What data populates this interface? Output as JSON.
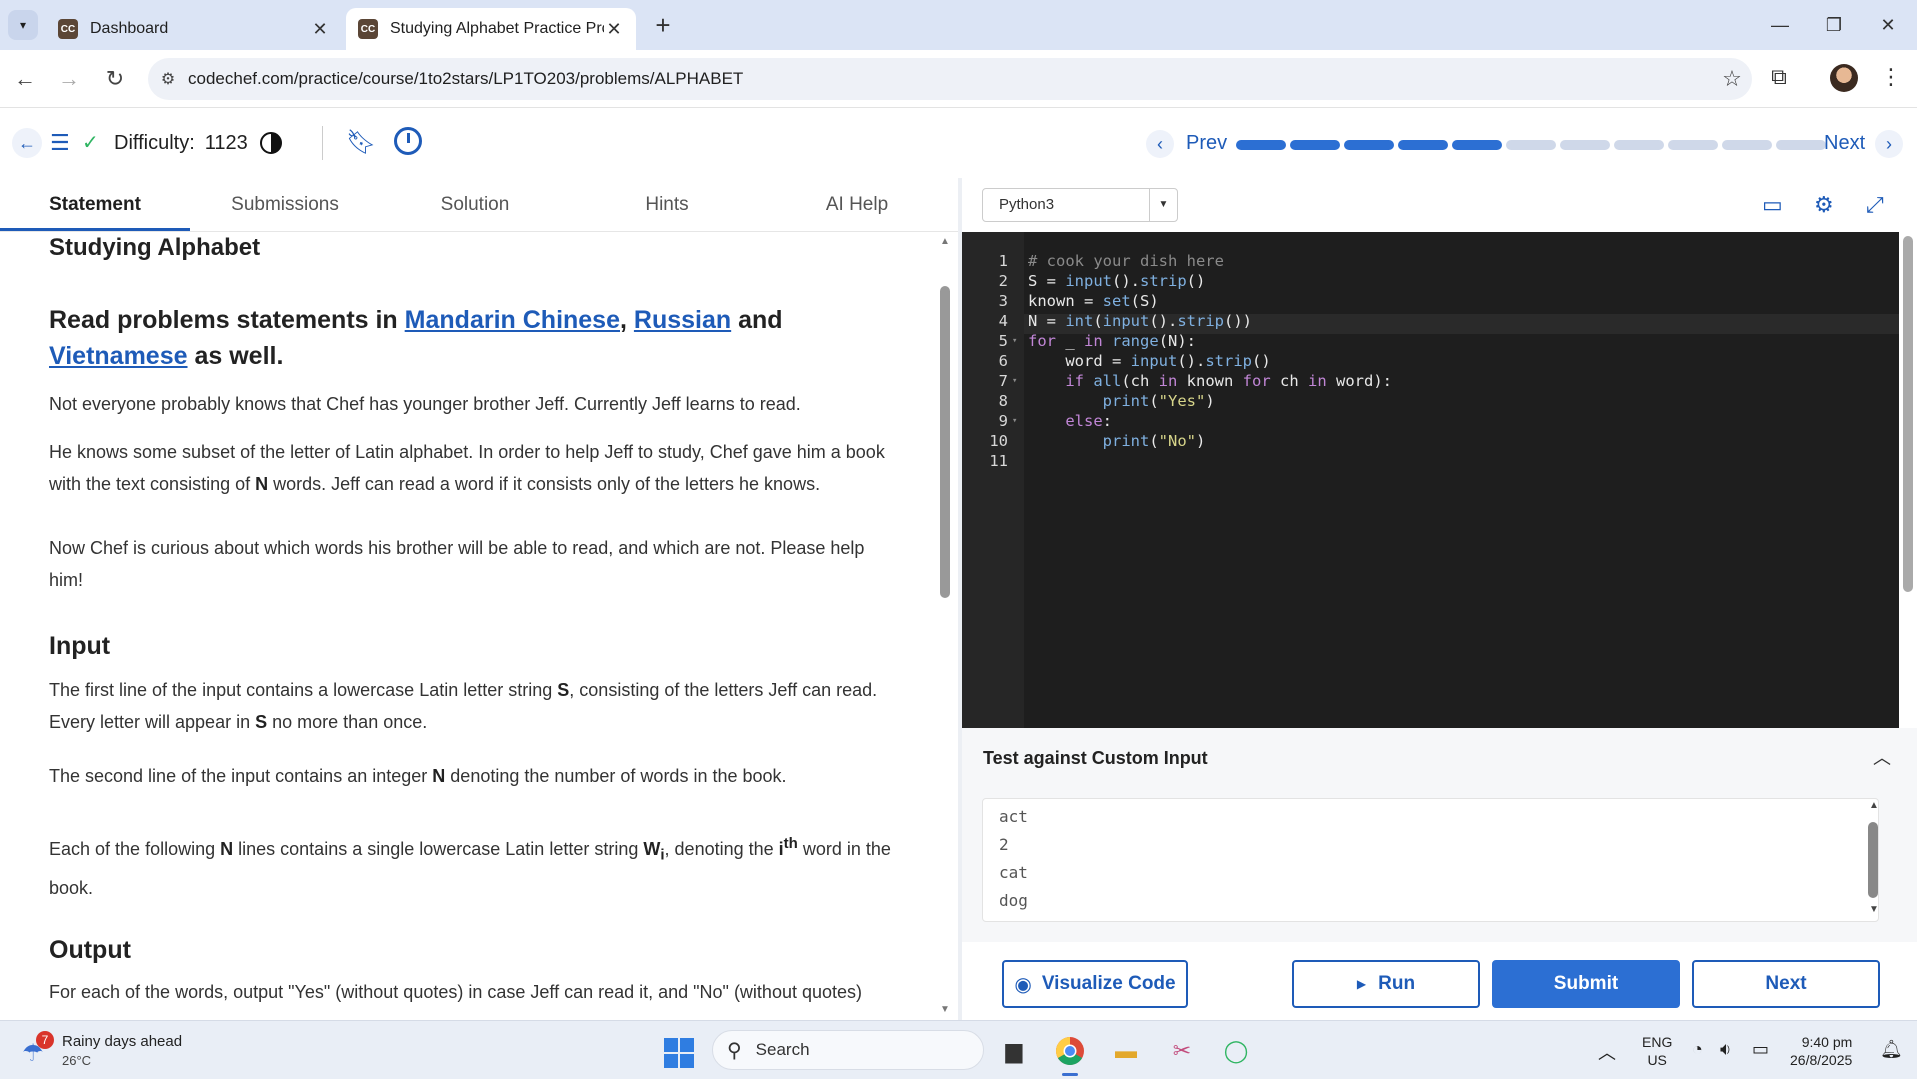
{
  "browser": {
    "tabs": [
      {
        "title": "Dashboard",
        "favicon": "CC"
      },
      {
        "title": "Studying Alphabet Practice Prob",
        "favicon": "CC"
      }
    ],
    "url": "codechef.com/practice/course/1to2stars/LP1TO203/problems/ALPHABET"
  },
  "header": {
    "difficulty_label": "Difficulty:",
    "difficulty_value": "1123",
    "prev_label": "Prev",
    "next_label": "Next",
    "progress_completed": 5,
    "progress_total": 11
  },
  "problem": {
    "tabs": [
      "Statement",
      "Submissions",
      "Solution",
      "Hints",
      "AI Help"
    ],
    "active_tab": "Statement",
    "title": "Studying Alphabet",
    "translations_prefix": "Read problems statements in",
    "lang_mandarin": "Mandarin Chinese",
    "lang_russian": "Russian",
    "and": "and",
    "lang_vietnamese": "Vietnamese",
    "as_well": "as well.",
    "para1": "Not everyone probably knows that Chef has younger brother Jeff. Currently Jeff learns to read.",
    "para2_a": "He knows some subset of the letter of Latin alphabet. In order to help Jeff to study, Chef gave him a book with the text consisting of",
    "para2_b": "N",
    "para2_c": "words. Jeff can read a word if it consists only of the letters he knows.",
    "para3": "Now Chef is curious about which words his brother will be able to read, and which are not. Please help him!",
    "input_heading": "Input",
    "input_p1_a": "The first line of the input contains a lowercase Latin letter string",
    "input_p1_b": "S",
    "input_p1_c": ", consisting of the letters Jeff can read. Every letter will appear in",
    "input_p1_d": "S",
    "input_p1_e": "no more than once.",
    "input_p2_a": "The second line of the input contains an integer",
    "input_p2_b": "N",
    "input_p2_c": "denoting the number of words in the book.",
    "input_p3_a": "Each of the following",
    "input_p3_b": "N",
    "input_p3_c": "lines contains a single lowercase Latin letter string",
    "input_p3_d": "W",
    "input_p3_sub": "i",
    "input_p3_e": ", denoting the",
    "input_p3_f": "i",
    "input_p3_sup": "th",
    "input_p3_g": "word in the book.",
    "output_heading": "Output",
    "output_p1": "For each of the words, output \"Yes\" (without quotes) in case Jeff can read it, and \"No\" (without quotes)"
  },
  "editor": {
    "language": "Python3",
    "line_numbers": [
      "1",
      "2",
      "3",
      "4",
      "5",
      "6",
      "7",
      "8",
      "9",
      "10",
      "11"
    ],
    "code_lines": [
      "# cook your dish here",
      "S = input().strip()",
      "known = set(S)",
      "N = int(input().strip())",
      "for _ in range(N):",
      "    word = input().strip()",
      "    if all(ch in known for ch in word):",
      "        print(\"Yes\")",
      "    else:",
      "        print(\"No\")",
      ""
    ]
  },
  "custom_input": {
    "title": "Test against Custom Input",
    "lines": [
      "act",
      "2",
      "cat",
      "dog"
    ]
  },
  "actions": {
    "visualize": "Visualize Code",
    "run": "Run",
    "submit": "Submit",
    "next": "Next"
  },
  "taskbar": {
    "weather_title": "Rainy days ahead",
    "weather_temp": "26°C",
    "weather_badge": "7",
    "search_placeholder": "Search",
    "lang_line1": "ENG",
    "lang_line2": "US",
    "time": "9:40 pm",
    "date": "26/8/2025"
  },
  "colors": {
    "accent": "#2c6fd3",
    "link": "#1e5bb8",
    "editor_bg": "#1e1e1e",
    "success": "#2fb562"
  }
}
